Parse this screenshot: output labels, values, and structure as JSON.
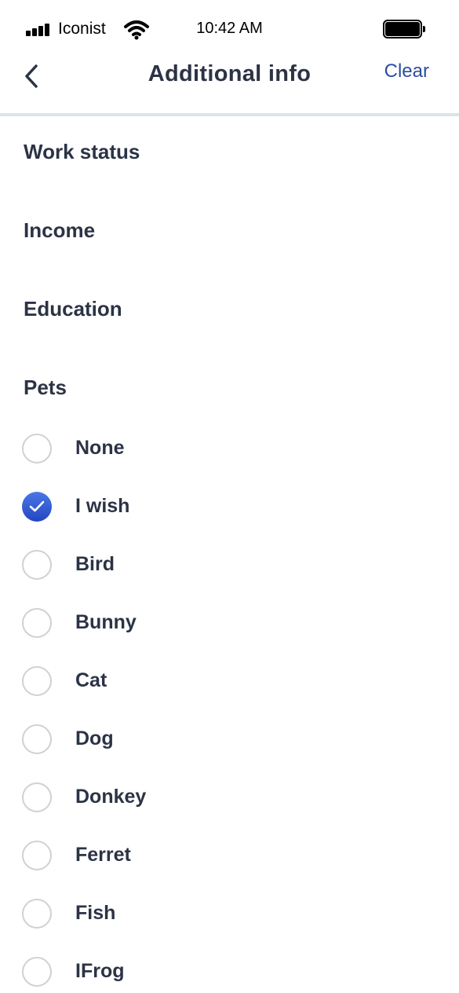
{
  "status_bar": {
    "carrier": "Iconist",
    "time": "10:42 AM",
    "icons": [
      "signal-icon",
      "wifi-icon",
      "battery-icon"
    ]
  },
  "nav": {
    "title": "Additional info",
    "clear_label": "Clear",
    "back_icon": "chevron-left-icon"
  },
  "sections": {
    "work_status": "Work status",
    "income": "Income",
    "education": "Education",
    "pets": "Pets"
  },
  "pets_options": [
    {
      "label": "None",
      "checked": false
    },
    {
      "label": "I wish",
      "checked": true
    },
    {
      "label": "Bird",
      "checked": false
    },
    {
      "label": "Bunny",
      "checked": false
    },
    {
      "label": "Cat",
      "checked": false
    },
    {
      "label": "Dog",
      "checked": false
    },
    {
      "label": "Donkey",
      "checked": false
    },
    {
      "label": "Ferret",
      "checked": false
    },
    {
      "label": "Fish",
      "checked": false
    },
    {
      "label": "IFrog",
      "checked": false
    }
  ],
  "colors": {
    "text": "#2b3345",
    "accent": "#2a4ea0",
    "checked_radio": "#3359d6",
    "divider": "#dde3e6",
    "radio_border": "#cdd2d6"
  }
}
